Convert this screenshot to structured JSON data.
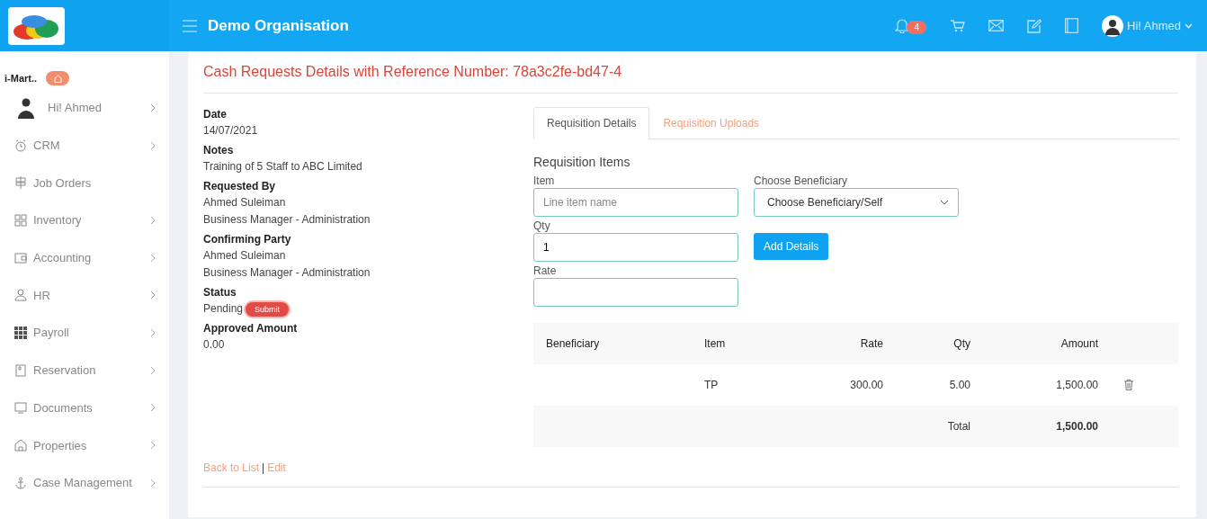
{
  "header": {
    "title": "Demo Organisation",
    "notification_count": "4",
    "user_greeting": "Hi! Ahmed"
  },
  "sidebar": {
    "org": "i-Mart..",
    "user": "Hi! Ahmed",
    "items": [
      {
        "label": "CRM",
        "expandable": true
      },
      {
        "label": "Job Orders",
        "expandable": false
      },
      {
        "label": "Inventory",
        "expandable": true
      },
      {
        "label": "Accounting",
        "expandable": true
      },
      {
        "label": "HR",
        "expandable": true
      },
      {
        "label": "Payroll",
        "expandable": true
      },
      {
        "label": "Reservation",
        "expandable": true
      },
      {
        "label": "Documents",
        "expandable": true
      },
      {
        "label": "Properties",
        "expandable": true
      },
      {
        "label": "Case Management",
        "expandable": true
      }
    ]
  },
  "page_title": "Cash Requests Details with Reference Number: 78a3c2fe-bd47-4",
  "details": [
    {
      "label": "Date",
      "lines": [
        "14/07/2021"
      ]
    },
    {
      "label": "Notes",
      "lines": [
        "Training of 5 Staff to ABC Limited"
      ]
    },
    {
      "label": "Requested By",
      "lines": [
        "Ahmed Suleiman",
        "Business Manager - Administration"
      ]
    },
    {
      "label": "Confirming Party",
      "lines": [
        "Ahmed Suleiman",
        "Business Manager - Administration"
      ]
    },
    {
      "label": "Status",
      "lines": [
        "Pending"
      ],
      "action": "Submit"
    },
    {
      "label": "Approved Amount",
      "lines": [
        "0.00"
      ]
    }
  ],
  "links": {
    "back": "Back to List",
    "separator": "|",
    "edit": "Edit"
  },
  "tabs": [
    {
      "label": "Requisition Details",
      "selected": true
    },
    {
      "label": "Requisition Uploads",
      "selected": false
    }
  ],
  "form": {
    "title": "Requisition Items",
    "item_label": "Item",
    "item_placeholder": "Line item name",
    "beneficiary_label": "Choose Beneficiary",
    "beneficiary_value": "Choose Beneficiary/Self",
    "qty_label": "Qty",
    "qty_value": "1",
    "rate_label": "Rate",
    "add_button": "Add Details"
  },
  "table": {
    "columns": [
      "Beneficiary",
      "Item",
      "Rate",
      "Qty",
      "Amount"
    ],
    "rows": [
      {
        "cells": [
          "",
          "TP",
          "300.00",
          "5.00",
          "1,500.00"
        ]
      }
    ],
    "total_label": "Total",
    "total": "1,500.00"
  }
}
